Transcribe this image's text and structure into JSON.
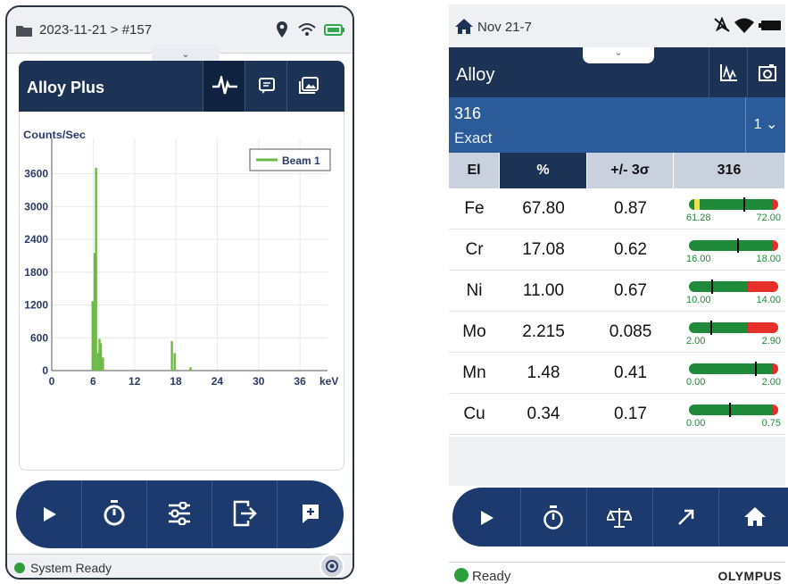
{
  "left": {
    "status": {
      "title": "2023-11-21 > #157"
    },
    "header": {
      "title": "Alloy Plus"
    },
    "status_bar": {
      "text": "System Ready"
    }
  },
  "chart_data": {
    "type": "bar",
    "ylabel": "Counts/Sec",
    "xlabel": "keV",
    "xlim": [
      0,
      40
    ],
    "ylim": [
      0,
      4000
    ],
    "grid": true,
    "legend_position": "top-right",
    "x_ticks": [
      0,
      6,
      12,
      18,
      24,
      30,
      36
    ],
    "y_ticks": [
      0,
      600,
      1200,
      1800,
      2400,
      3000,
      3600
    ],
    "series": [
      {
        "name": "Beam 1",
        "color": "#6dbb45",
        "x": [
          5.9,
          6.2,
          6.4,
          6.7,
          6.9,
          7.1,
          7.4,
          17.4,
          17.8,
          20.1
        ],
        "values": [
          1270,
          2150,
          3710,
          320,
          580,
          500,
          240,
          540,
          320,
          60
        ]
      }
    ]
  },
  "right": {
    "status": {
      "title": "Nov 21-7"
    },
    "header": {
      "title": "Alloy"
    },
    "grade": {
      "name": "316",
      "match": "Exact",
      "selector": "1"
    },
    "table": {
      "headers": [
        "El",
        "%",
        "+/- 3σ",
        "316"
      ],
      "rows": [
        {
          "el": "Fe",
          "pct": "67.80",
          "err": "0.87",
          "lo": "61.28",
          "hi": "72.00",
          "value": 67.8,
          "min": 61.28,
          "max": 72.0
        },
        {
          "el": "Cr",
          "pct": "17.08",
          "err": "0.62",
          "lo": "16.00",
          "hi": "18.00",
          "value": 17.08,
          "min": 16.0,
          "max": 18.0
        },
        {
          "el": "Ni",
          "pct": "11.00",
          "err": "0.67",
          "lo": "10.00",
          "hi": "14.00",
          "value": 11.0,
          "min": 10.0,
          "max": 14.0
        },
        {
          "el": "Mo",
          "pct": "2.215",
          "err": "0.085",
          "lo": "2.00",
          "hi": "2.90",
          "value": 2.215,
          "min": 2.0,
          "max": 2.9
        },
        {
          "el": "Mn",
          "pct": "1.48",
          "err": "0.41",
          "lo": "0.00",
          "hi": "2.00",
          "value": 1.48,
          "min": 0.0,
          "max": 2.0
        },
        {
          "el": "Cu",
          "pct": "0.34",
          "err": "0.17",
          "lo": "0.00",
          "hi": "0.75",
          "value": 0.34,
          "min": 0.0,
          "max": 0.75
        }
      ]
    },
    "status_bar": {
      "text": "Ready",
      "brand": "OLYMPUS"
    }
  },
  "colors": {
    "navy": "#1d3356",
    "blue": "#2c5b9a",
    "green": "#1e8a3a",
    "spectrum": "#6dbb45",
    "red": "#e8302a",
    "yellow": "#f0e04a"
  }
}
